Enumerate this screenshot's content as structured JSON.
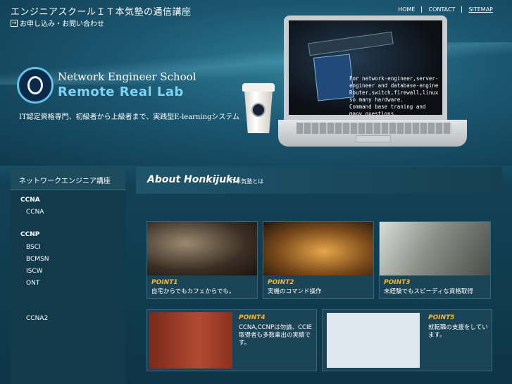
{
  "header": {
    "school_title": "エンジニアスクールＩＴ本気塾の通信講座",
    "contact_link": "お申し込み・お問い合わせ",
    "nav": [
      "HOME",
      "CONTACT",
      "SITEMAP"
    ]
  },
  "hero": {
    "logo_line1": "Network Engineer School",
    "logo_line2": "Remote Real Lab",
    "tagline": "IT認定資格専門、初級者から上級者まで、実践型E-learningシステム",
    "terminal_text": "For network-engineer,server-\nengineer and database-engine\nRouter,switch,firewall,linux\nso many hardware.\nCommand base traning and\nmany questions."
  },
  "sidebar": {
    "title": "ネットワークエンジニア講座",
    "sections": [
      {
        "category": "CCNA",
        "items": [
          "CCNA"
        ]
      },
      {
        "category": "CCNP",
        "items": [
          "BSCI",
          "BCMSN",
          "ISCW",
          "ONT"
        ]
      }
    ],
    "extra_item": "CCNA2"
  },
  "main": {
    "heading": "About Honkijuku",
    "subheading": "IT本気塾とは",
    "points": [
      {
        "label": "POINT1",
        "desc": "自宅からでもカフェからでも。"
      },
      {
        "label": "POINT2",
        "desc": "実機のコマンド操作"
      },
      {
        "label": "POINT3",
        "desc": "未経験でもスピーディな資格取得"
      },
      {
        "label": "POINT4",
        "desc": "CCNA,CCNPは勿論、CCIE取得者も多数輩出の実績です。"
      },
      {
        "label": "POINT5",
        "desc": "就転職の支援をしています。"
      }
    ]
  },
  "colors": {
    "accent_point": "#f4b72b",
    "logo_blue": "#7fd2f2"
  }
}
